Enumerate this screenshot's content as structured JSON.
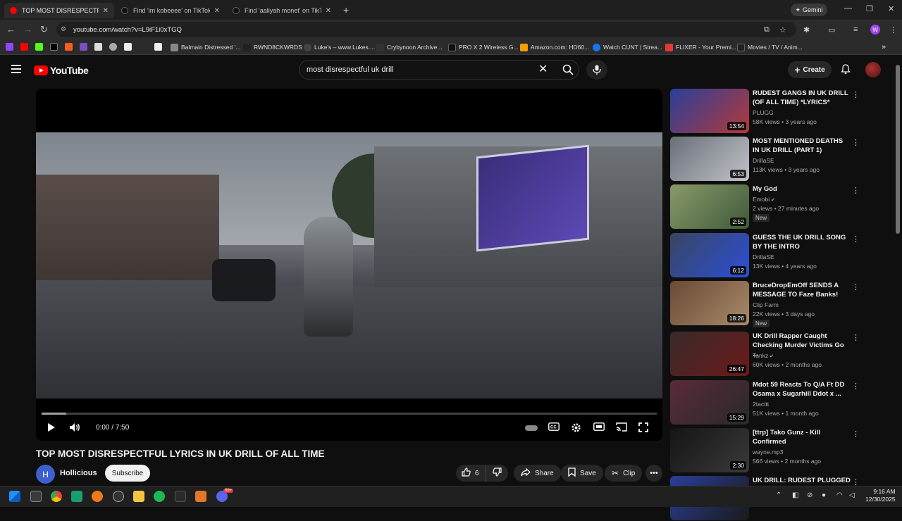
{
  "browser": {
    "tabs": [
      {
        "title": "TOP MOST DISRESPECTFUL LYRI",
        "close": "✕",
        "favicon_color": "#ff0000",
        "active": true
      },
      {
        "title": "Find 'im kobeeee' on TikTok | Ti",
        "close": "✕",
        "favicon_color": "#111111",
        "active": false
      },
      {
        "title": "Find 'aaliyah monet' on TikTok",
        "close": "✕",
        "favicon_color": "#111111",
        "active": false
      }
    ],
    "new_tab": "+",
    "gemini_label": "Gemini",
    "url": "youtube.com/watch?v=L9iF1i0xTGQ",
    "profile_initial": "W",
    "bookmarks": [
      {
        "label": "Balmain Distressed '...",
        "color": "#888888"
      },
      {
        "label": "RWND8CKWRDS",
        "color": "#222222"
      },
      {
        "label": "Luke's – www.Lukes....",
        "color": "#444444"
      },
      {
        "label": "Crybynoon Archive...",
        "color": "#333333"
      },
      {
        "label": "PRO X 2 Wireless G...",
        "color": "#111111"
      },
      {
        "label": "Amazon.com: HD60...",
        "color": "#f0a000"
      },
      {
        "label": "Watch CUNT | Strea...",
        "color": "#1a73e8"
      },
      {
        "label": "FLIXER - Your Premi...",
        "color": "#e53935"
      },
      {
        "label": "Movies / TV / Anim...",
        "color": "#222222"
      }
    ]
  },
  "youtube": {
    "logo_text": "YouTube",
    "search_value": "most disrespectful uk drill",
    "create_label": "Create",
    "player": {
      "current_time": "0:00",
      "duration": "7:50",
      "time_display": "0:00 / 7:50",
      "buffered_fraction": 0.04
    },
    "video_title": "TOP MOST DISRESPECTFUL LYRICS IN UK DRILL OF ALL TIME",
    "channel": {
      "initial": "H",
      "name": "Hollicious"
    },
    "subscribe_label": "Subscribe",
    "actions": {
      "likes": "6",
      "share": "Share",
      "save": "Save",
      "clip": "Clip"
    },
    "recommendations": [
      {
        "title": "RUDEST GANGS IN UK DRILL (OF ALL TIME) *LYRICS*",
        "channel": "PLUGG",
        "meta": "58K views • 3 years ago",
        "duration": "13:54",
        "verified": false,
        "new": false,
        "thumb": [
          "#2a3f9a",
          "#b23a3a"
        ]
      },
      {
        "title": "MOST MENTIONED DEATHS IN UK DRILL (PART 1)",
        "channel": "DrillaSE",
        "meta": "113K views • 3 years ago",
        "duration": "6:53",
        "verified": false,
        "new": false,
        "thumb": [
          "#6a6f78",
          "#c0c3c8"
        ]
      },
      {
        "title": "My God",
        "channel": "Emobi",
        "meta": "2 views • 27 minutes ago",
        "duration": "2:52",
        "verified": true,
        "new": true,
        "thumb": [
          "#8a9a6a",
          "#3f5a3a"
        ]
      },
      {
        "title": "GUESS THE UK DRILL SONG BY THE INTRO",
        "channel": "DrillaSE",
        "meta": "13K views • 4 years ago",
        "duration": "6:12",
        "verified": false,
        "new": false,
        "thumb": [
          "#3a4560",
          "#2c4fd6"
        ]
      },
      {
        "title": "BruceDropEmOff SENDS A MESSAGE TO Faze Banks!",
        "channel": "Clip Farm",
        "meta": "22K views • 3 days ago",
        "duration": "18:26",
        "verified": false,
        "new": true,
        "thumb": [
          "#6a4a35",
          "#a88a6a"
        ]
      },
      {
        "title": "UK Drill Rapper Caught Checking Murder Victims Go ...",
        "channel": "Tankz",
        "meta": "60K views • 2 months ago",
        "duration": "26:47",
        "verified": true,
        "new": false,
        "thumb": [
          "#3a2a2a",
          "#6a1a1a"
        ]
      },
      {
        "title": "Mdot 59 Reacts To Q/A Ft DD Osama x Sugarhill Ddot x ...",
        "channel": "2tacttt",
        "meta": "51K views • 1 month ago",
        "duration": "15:29",
        "verified": false,
        "new": false,
        "thumb": [
          "#5a2a3a",
          "#2a2a2a"
        ]
      },
      {
        "title": "[ttrp] Tako Gunz - Kill Confirmed",
        "channel": "wayne.mp3",
        "meta": "566 views • 2 months ago",
        "duration": "2:30",
        "verified": false,
        "new": false,
        "thumb": [
          "#151515",
          "#3a3a3a"
        ]
      },
      {
        "title": "UK DRILL: RUDEST PLUGGED IN",
        "channel": "",
        "meta": "",
        "duration": "",
        "verified": false,
        "new": false,
        "thumb": [
          "#2a3f9a",
          "#1a1a1a"
        ]
      }
    ],
    "new_badge_label": "New"
  },
  "taskbar": {
    "time": "9:16 AM",
    "date": "12/30/2025",
    "notification_badge": "99+"
  }
}
